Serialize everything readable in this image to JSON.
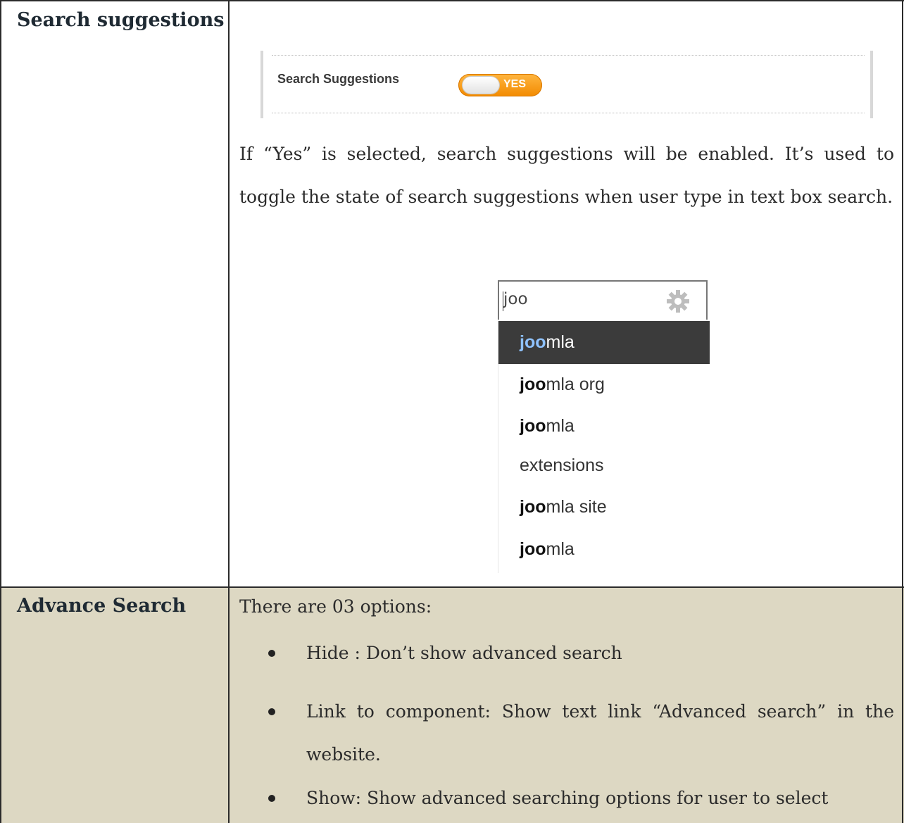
{
  "rows": [
    {
      "label": "Search suggestions",
      "setting": {
        "label": "Search Suggestions",
        "toggle_value": "YES"
      },
      "description": "If “Yes” is selected, search suggestions will be enabled. It’s used to toggle the state of search suggestions when user type in text box search.",
      "widget": {
        "query": "joo",
        "icon": "gear-icon",
        "suggestions": [
          {
            "match": "joo",
            "rest": "mla",
            "selected": true
          },
          {
            "match": "joo",
            "rest": "mla org",
            "selected": false
          },
          {
            "match": "joo",
            "rest": "mla",
            "selected": false
          },
          {
            "match": "",
            "rest": "extensions",
            "selected": false
          },
          {
            "match": "joo",
            "rest": "mla site",
            "selected": false
          },
          {
            "match": "joo",
            "rest": "mla",
            "selected": false
          }
        ]
      }
    },
    {
      "label": "Advance Search",
      "intro": "There are 03 options:",
      "options": [
        "Hide : Don’t show advanced search",
        "Link to component: Show text link “Advanced search” in the website.",
        "Show: Show advanced searching options for user to select"
      ]
    }
  ],
  "colors": {
    "row2_bg": "#ddd8c3",
    "toggle": "#f7a01d",
    "selected_bg": "#3b3b3b"
  }
}
